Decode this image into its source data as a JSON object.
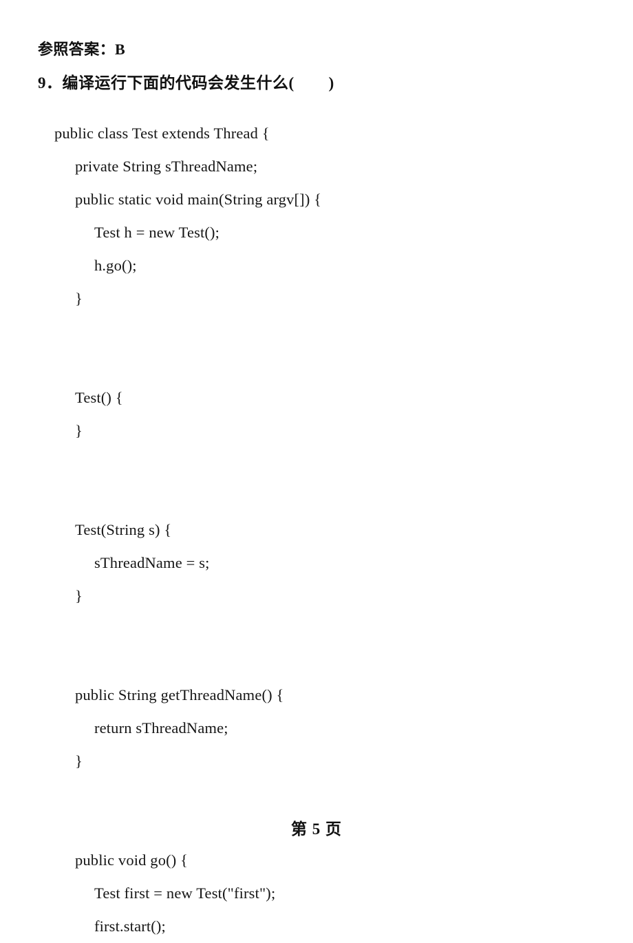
{
  "document": {
    "answer_line": "参照答案：B",
    "question": "9．编译运行下面的代码会发生什么(        )",
    "code_lines": [
      {
        "indent": 0,
        "text": "public class Test extends Thread {"
      },
      {
        "indent": 1,
        "text": "private String sThreadName;"
      },
      {
        "indent": 1,
        "text": "public static void main(String argv[]) {"
      },
      {
        "indent": 2,
        "text": "Test h = new Test();"
      },
      {
        "indent": 2,
        "text": "h.go();"
      },
      {
        "indent": 1,
        "text": "}"
      },
      {
        "indent": 1,
        "text": ""
      },
      {
        "indent": 1,
        "text": ""
      },
      {
        "indent": 1,
        "text": "Test() {"
      },
      {
        "indent": 1,
        "text": "}"
      },
      {
        "indent": 1,
        "text": ""
      },
      {
        "indent": 1,
        "text": ""
      },
      {
        "indent": 1,
        "text": "Test(String s) {"
      },
      {
        "indent": 2,
        "text": "sThreadName = s;"
      },
      {
        "indent": 1,
        "text": "}"
      },
      {
        "indent": 1,
        "text": ""
      },
      {
        "indent": 1,
        "text": ""
      },
      {
        "indent": 1,
        "text": "public String getThreadName() {"
      },
      {
        "indent": 2,
        "text": "return sThreadName;"
      },
      {
        "indent": 1,
        "text": "}"
      },
      {
        "indent": 1,
        "text": ""
      },
      {
        "indent": 1,
        "text": ""
      },
      {
        "indent": 1,
        "text": "public void go() {"
      },
      {
        "indent": 2,
        "text": "Test first = new Test(\"first\");"
      },
      {
        "indent": 2,
        "text": "first.start();"
      }
    ],
    "footer": "第 5 页"
  }
}
